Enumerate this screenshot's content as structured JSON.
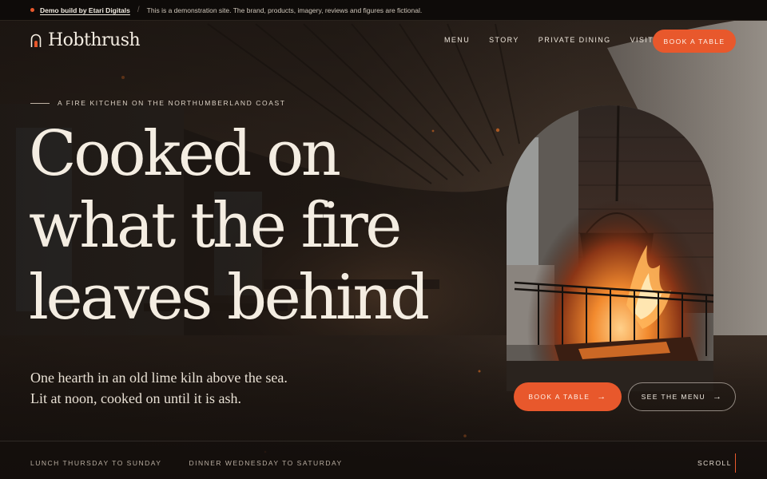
{
  "demo": {
    "link_text": "Demo build by Etari Digitals",
    "separator": "/",
    "notice": "This is a demonstration site. The brand, products, imagery, reviews and figures are fictional."
  },
  "header": {
    "brand": "Hobthrush",
    "brand_icon": "kiln-arch-icon",
    "nav": [
      "MENU",
      "STORY",
      "PRIVATE DINING",
      "VISIT"
    ],
    "book_label": "BOOK A TABLE"
  },
  "hero": {
    "eyebrow": "A FIRE KITCHEN ON THE NORTHUMBERLAND COAST",
    "headline_lines": [
      "Cooked on",
      "what the fire",
      "leaves behind"
    ],
    "lede": "One hearth in an old lime kiln above the sea. Lit at noon, cooked on until it is ash.",
    "primary_cta": "BOOK A TABLE",
    "secondary_cta": "SEE THE MENU",
    "cta_arrow": "→"
  },
  "footer": {
    "hours": [
      "LUNCH THURSDAY TO SUNDAY",
      "DINNER WEDNESDAY TO SATURDAY"
    ],
    "scroll": "SCROLL"
  },
  "colors": {
    "accent": "#e8582c",
    "background": "#1b1511",
    "text": "#f4ede2"
  }
}
